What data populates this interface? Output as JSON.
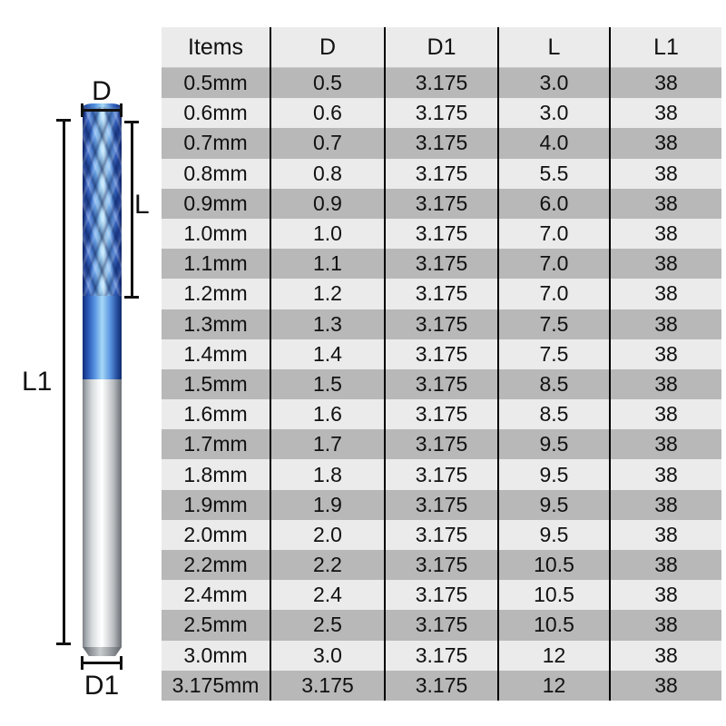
{
  "diagram": {
    "labels": {
      "d": "D",
      "d1": "D1",
      "l": "L",
      "l1": "L1"
    },
    "tool": {
      "name": "corn-tooth-end-mill",
      "coating_color": "#2a55b8",
      "shank_color": "#d7dadc"
    }
  },
  "table": {
    "headers": [
      "Items",
      "D",
      "D1",
      "L",
      "L1"
    ],
    "rows": [
      [
        "0.5mm",
        "0.5",
        "3.175",
        "3.0",
        "38"
      ],
      [
        "0.6mm",
        "0.6",
        "3.175",
        "3.0",
        "38"
      ],
      [
        "0.7mm",
        "0.7",
        "3.175",
        "4.0",
        "38"
      ],
      [
        "0.8mm",
        "0.8",
        "3.175",
        "5.5",
        "38"
      ],
      [
        "0.9mm",
        "0.9",
        "3.175",
        "6.0",
        "38"
      ],
      [
        "1.0mm",
        "1.0",
        "3.175",
        "7.0",
        "38"
      ],
      [
        "1.1mm",
        "1.1",
        "3.175",
        "7.0",
        "38"
      ],
      [
        "1.2mm",
        "1.2",
        "3.175",
        "7.0",
        "38"
      ],
      [
        "1.3mm",
        "1.3",
        "3.175",
        "7.5",
        "38"
      ],
      [
        "1.4mm",
        "1.4",
        "3.175",
        "7.5",
        "38"
      ],
      [
        "1.5mm",
        "1.5",
        "3.175",
        "8.5",
        "38"
      ],
      [
        "1.6mm",
        "1.6",
        "3.175",
        "8.5",
        "38"
      ],
      [
        "1.7mm",
        "1.7",
        "3.175",
        "9.5",
        "38"
      ],
      [
        "1.8mm",
        "1.8",
        "3.175",
        "9.5",
        "38"
      ],
      [
        "1.9mm",
        "1.9",
        "3.175",
        "9.5",
        "38"
      ],
      [
        "2.0mm",
        "2.0",
        "3.175",
        "9.5",
        "38"
      ],
      [
        "2.2mm",
        "2.2",
        "3.175",
        "10.5",
        "38"
      ],
      [
        "2.4mm",
        "2.4",
        "3.175",
        "10.5",
        "38"
      ],
      [
        "2.5mm",
        "2.5",
        "3.175",
        "10.5",
        "38"
      ],
      [
        "3.0mm",
        "3.0",
        "3.175",
        "12",
        "38"
      ],
      [
        "3.175mm",
        "3.175",
        "3.175",
        "12",
        "38"
      ]
    ]
  },
  "colors": {
    "header_bg": "#ebebeb",
    "row_odd_bg": "#b8b8b8",
    "row_even_bg": "#ebebeb",
    "divider": "#000000",
    "text": "#111111"
  }
}
